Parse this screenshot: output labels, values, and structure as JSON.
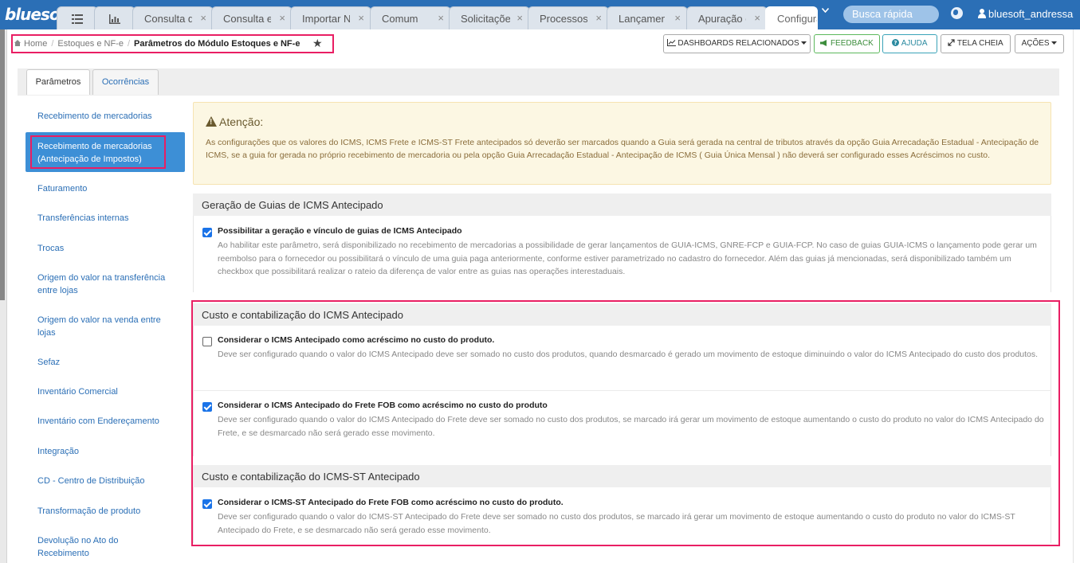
{
  "brand": {
    "logo": "bluesoft",
    "accent": "#2b6fb6",
    "highlight": "#e91e63"
  },
  "tabs": [
    {
      "label": "Consulta d",
      "close": "×"
    },
    {
      "label": "Consulta e",
      "close": "×"
    },
    {
      "label": "Importar N",
      "close": "×"
    },
    {
      "label": "Comum",
      "close": "×"
    },
    {
      "label": "Solicitaçõe",
      "close": "×"
    },
    {
      "label": "Processos",
      "close": "×"
    },
    {
      "label": "Lançamen",
      "close": "×"
    },
    {
      "label": "Apuração d",
      "close": "×"
    },
    {
      "label": "Configura",
      "close": ""
    }
  ],
  "topbar": {
    "search_placeholder": "Busca rápida",
    "username": "bluesoft_andressa",
    "tab_icons": [
      "list-icon",
      "bar-chart-icon"
    ]
  },
  "breadcrumb": {
    "home": "Home",
    "sep": "/",
    "parent": "Estoques e NF-e",
    "current": "Parâmetros do Módulo Estoques e NF-e",
    "star": "★"
  },
  "actions": {
    "dashboards": "DASHBOARDS RELACIONADOS",
    "feedback": "FEEDBACK",
    "ajuda": "AJUDA",
    "tela_cheia": "TELA CHEIA",
    "acoes": "AÇÕES"
  },
  "panel_tabs": {
    "parametros": "Parâmetros",
    "ocorrencias": "Ocorrências"
  },
  "sidebar": [
    {
      "label": "Recebimento de mercadorias"
    },
    {
      "label": "Recebimento de mercadorias (Antecipação de Impostos)",
      "active": true
    },
    {
      "label": "Faturamento"
    },
    {
      "label": "Transferências internas"
    },
    {
      "label": "Trocas"
    },
    {
      "label": "Origem do valor na transferência entre lojas"
    },
    {
      "label": "Origem do valor na venda entre lojas"
    },
    {
      "label": "Sefaz"
    },
    {
      "label": "Inventário Comercial"
    },
    {
      "label": "Inventário com Endereçamento"
    },
    {
      "label": "Integração"
    },
    {
      "label": "CD - Centro de Distribuição"
    },
    {
      "label": "Transformação de produto"
    },
    {
      "label": "Devolução no Ato do Recebimento"
    }
  ],
  "alert": {
    "title": "Atenção:",
    "text": "As configurações que os valores do ICMS, ICMS Frete e ICMS-ST Frete antecipados só deverão ser marcados quando a Guia será gerada na central de tributos através da opção Guia Arrecadação Estadual - Antecipação de ICMS, se a guia for gerada no próprio recebimento de mercadoria ou pela opção Guia Arrecadação Estadual - Antecipação de ICMS ( Guia Única Mensal ) não deverá ser configurado esses Acréscimos no custo."
  },
  "sections": {
    "guias": {
      "title": "Geração de Guias de ICMS Antecipado",
      "option": {
        "checked": true,
        "label": "Possibilitar a geração e vínculo de guias de ICMS Antecipado",
        "description": "Ao habilitar este parâmetro, será disponibilizado no recebimento de mercadorias a possibilidade de gerar lançamentos de GUIA-ICMS, GNRE-FCP e GUIA-FCP. No caso de guias GUIA-ICMS o lançamento pode gerar um reembolso para o fornecedor ou possibilitará o vínculo de uma guia paga anteriormente, conforme estiver parametrizado no cadastro do fornecedor. Além das guias já mencionadas, será disponibilizado também um checkbox que possibilitará realizar o rateio da diferença de valor entre as guias nas operações interestaduais."
      }
    },
    "custo_icms": {
      "title": "Custo e contabilização do ICMS Antecipado",
      "options": [
        {
          "checked": false,
          "label": "Considerar o ICMS Antecipado como acréscimo no custo do produto.",
          "description": "Deve ser configurado quando o valor do ICMS Antecipado deve ser somado no custo dos produtos, quando desmarcado é gerado um movimento de estoque diminuindo o valor do ICMS Antecipado do custo dos produtos."
        },
        {
          "checked": true,
          "label": "Considerar o ICMS Antecipado do Frete FOB como acréscimo no custo do produto",
          "description": "Deve ser configurado quando o valor do ICMS Antecipado do Frete deve ser somado no custo dos produtos, se marcado irá gerar um movimento de estoque aumentando o custo do produto no valor do ICMS Antecipado do Frete, e se desmarcado não será gerado esse movimento."
        }
      ]
    },
    "custo_icms_st": {
      "title": "Custo e contabilização do ICMS-ST Antecipado",
      "option": {
        "checked": true,
        "label": "Considerar o ICMS-ST Antecipado do Frete FOB como acréscimo no custo do produto.",
        "description": "Deve ser configurado quando o valor do ICMS-ST Antecipado do Frete deve ser somado no custo dos produtos, se marcado irá gerar um movimento de estoque aumentando o custo do produto no valor do ICMS-ST Antecipado do Frete, e se desmarcado não será gerado esse movimento."
      }
    }
  }
}
